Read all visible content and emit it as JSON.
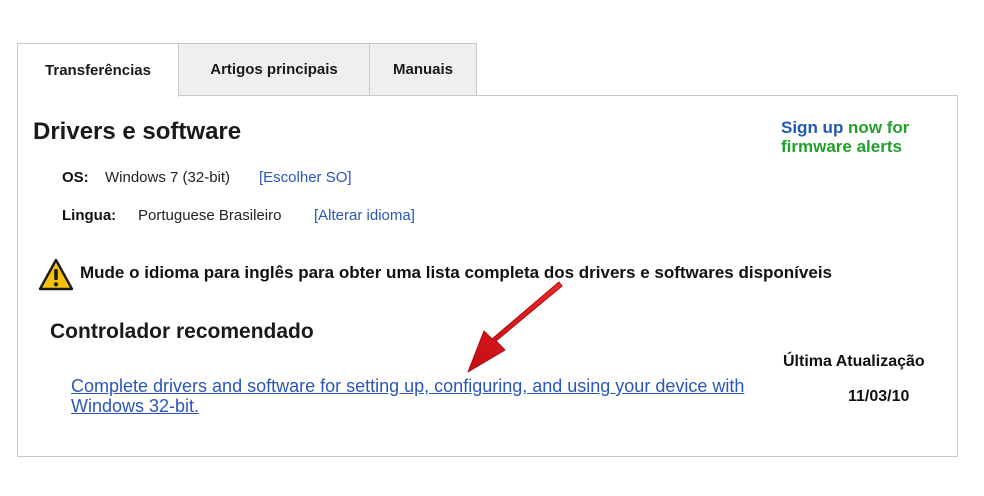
{
  "tabs": [
    {
      "label": "Transferências",
      "active": true
    },
    {
      "label": "Artigos principais",
      "active": false
    },
    {
      "label": "Manuais",
      "active": false
    }
  ],
  "panel": {
    "title": "Drivers e software",
    "signup": {
      "link": "Sign up",
      "rest": " now for firmware alerts"
    },
    "os": {
      "label": "OS:",
      "value": "Windows 7 (32-bit)",
      "link": "[Escolher SO]"
    },
    "language": {
      "label": "Lingua:",
      "value": "Portuguese Brasileiro",
      "link": "[Alterar idioma]"
    },
    "warning": {
      "icon": "warning-triangle-icon",
      "text": "Mude o idioma para inglês para obter uma lista completa dos drivers e softwares disponíveis"
    },
    "section_title": "Controlador recomendado",
    "column_header": "Última Atualização",
    "driver": {
      "link": "Complete drivers and software for setting up, configuring, and using your device with Windows 32-bit.",
      "date": "11/03/10"
    }
  },
  "colors": {
    "link_blue": "#2a56b8",
    "signup_green": "#22a02a",
    "warning_yellow": "#f4c20d",
    "arrow_red": "#e0141b"
  }
}
